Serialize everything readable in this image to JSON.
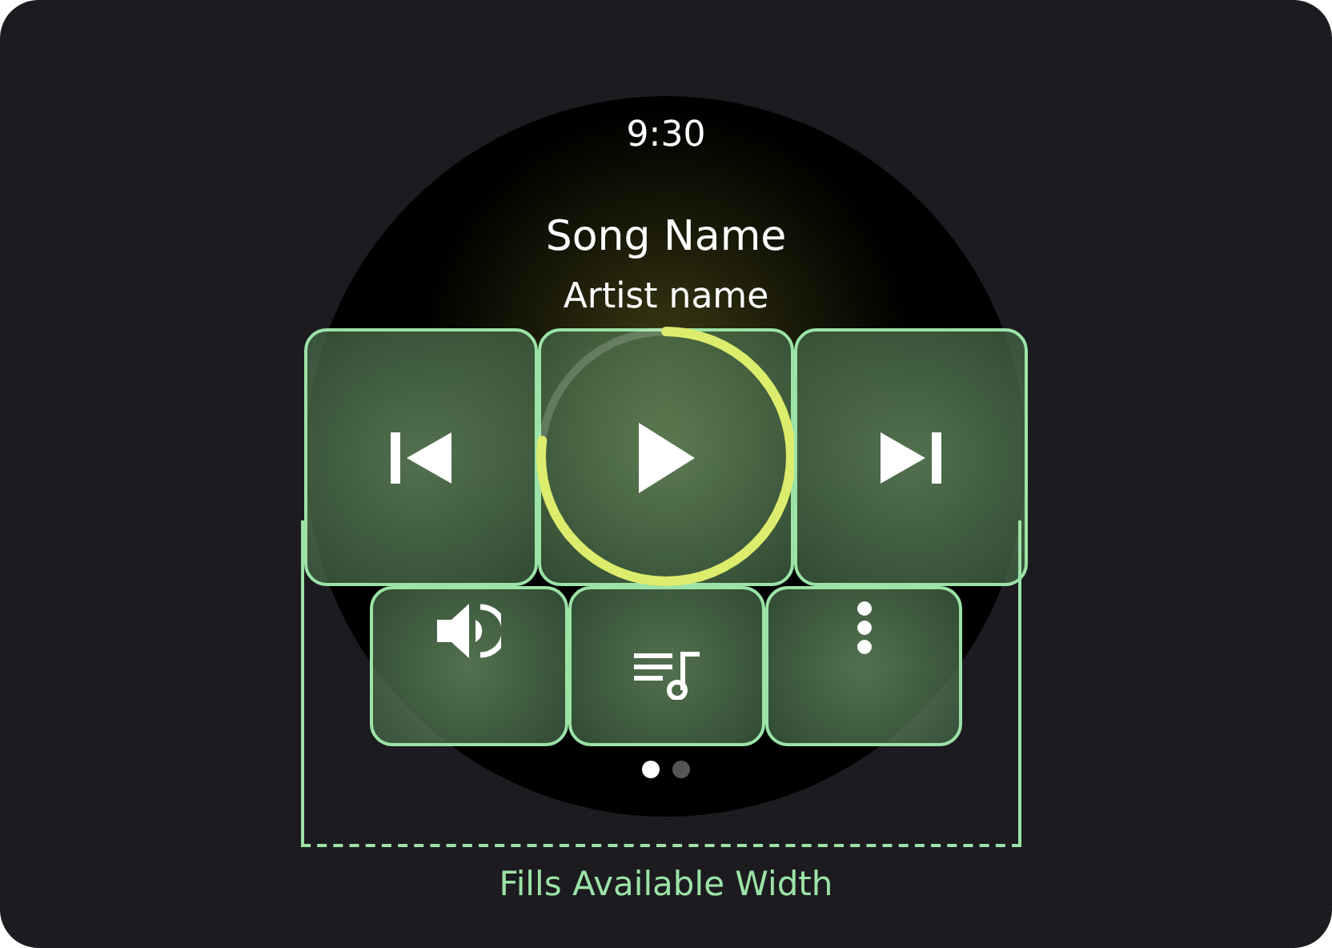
{
  "watch": {
    "time": "9:30",
    "song_title": "Song Name",
    "artist": "Artist name",
    "top_controls": [
      {
        "kind": "previous"
      },
      {
        "kind": "play"
      },
      {
        "kind": "next"
      }
    ],
    "bottom_controls": [
      {
        "kind": "volume"
      },
      {
        "kind": "queue"
      },
      {
        "kind": "more"
      }
    ],
    "page_dots": [
      {
        "selected": true
      },
      {
        "selected": false
      }
    ]
  },
  "annotation": {
    "label": "Fills Available Width"
  }
}
